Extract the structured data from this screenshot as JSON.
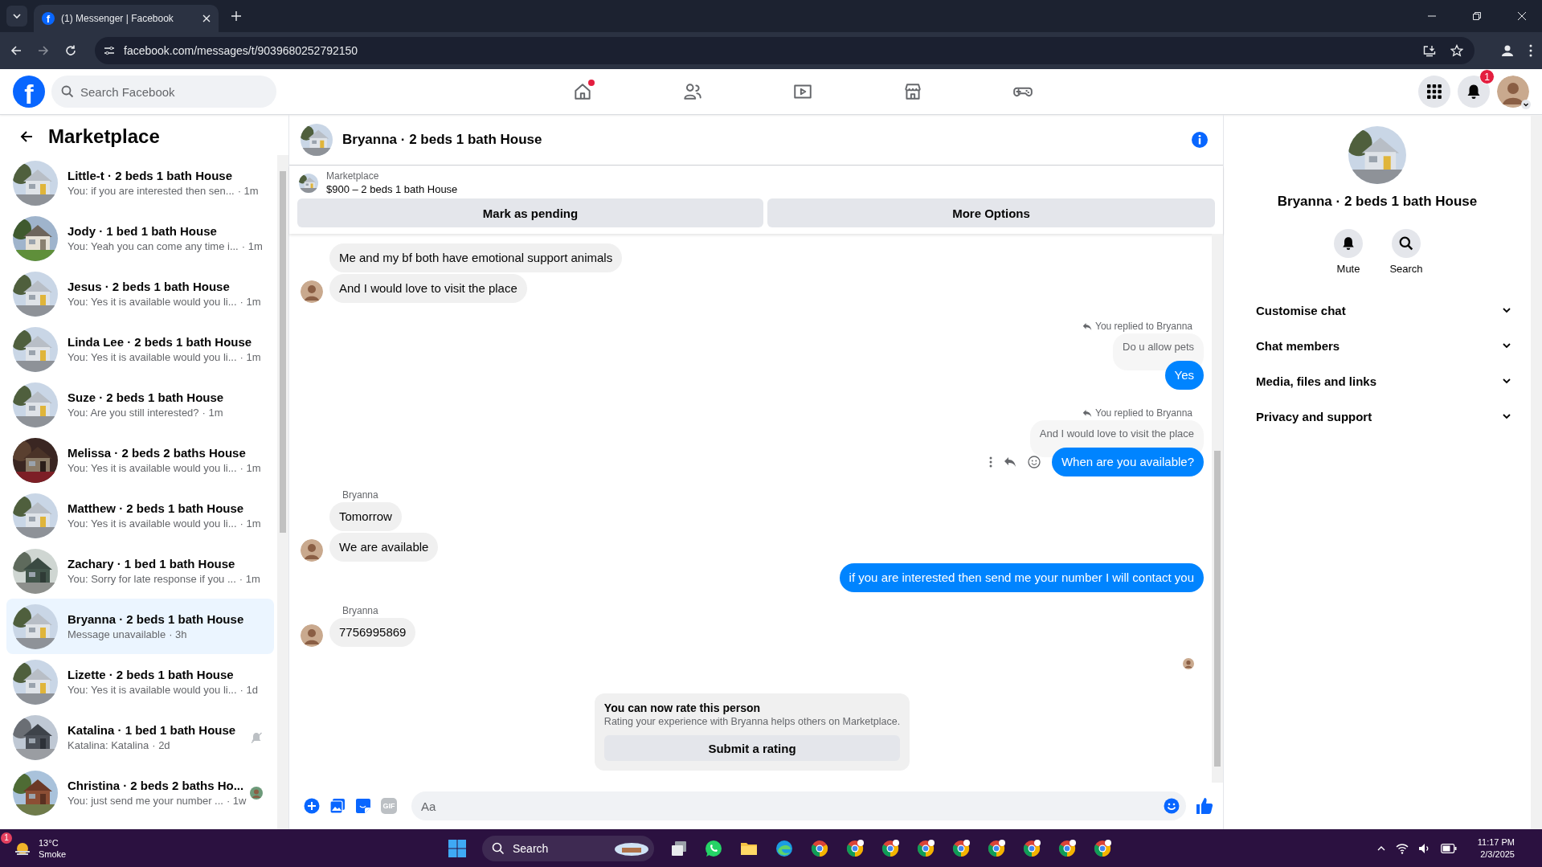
{
  "browser": {
    "favicon": "f",
    "tab_title": "(1) Messenger | Facebook",
    "url": "facebook.com/messages/t/9039680252792150"
  },
  "topbar": {
    "logo": "f",
    "search_placeholder": "Search Facebook",
    "nav": [
      {
        "kind": "home",
        "dot": true
      },
      {
        "kind": "friends",
        "dot": false
      },
      {
        "kind": "video",
        "dot": false
      },
      {
        "kind": "store",
        "dot": false
      },
      {
        "kind": "gaming",
        "dot": false
      }
    ],
    "notification_count": "1"
  },
  "sidebar": {
    "title": "Marketplace",
    "conversations": [
      {
        "title": "Little-t · 2 beds 1 bath House",
        "preview": "You: if you are interested then sen...",
        "time": "· 1m",
        "selected": false,
        "muted": false,
        "seen": false
      },
      {
        "title": "Jody · 1 bed 1 bath House",
        "preview": "You: Yeah you can come any time i...",
        "time": "· 1m",
        "selected": false,
        "muted": false,
        "seen": false
      },
      {
        "title": "Jesus · 2 beds 1 bath House",
        "preview": "You: Yes it is available would you li...",
        "time": "· 1m",
        "selected": false,
        "muted": false,
        "seen": false
      },
      {
        "title": "Linda Lee · 2 beds 1 bath House",
        "preview": "You: Yes it is available would you li...",
        "time": "· 1m",
        "selected": false,
        "muted": false,
        "seen": false
      },
      {
        "title": "Suze · 2 beds 1 bath House",
        "preview": "You: Are you still interested?",
        "time": "· 1m",
        "selected": false,
        "muted": false,
        "seen": false
      },
      {
        "title": "Melissa · 2 beds 2 baths House",
        "preview": "You: Yes it is available would you li...",
        "time": "· 1m",
        "selected": false,
        "muted": false,
        "seen": false
      },
      {
        "title": "Matthew · 2 beds 1 bath House",
        "preview": "You: Yes it is available would you li...",
        "time": "· 1m",
        "selected": false,
        "muted": false,
        "seen": false
      },
      {
        "title": "Zachary · 1 bed 1 bath House",
        "preview": "You: Sorry for late response if you ...",
        "time": "· 1m",
        "selected": false,
        "muted": false,
        "seen": false
      },
      {
        "title": "Bryanna · 2 beds 1 bath House",
        "preview": "Message unavailable",
        "time": "· 3h",
        "selected": true,
        "muted": false,
        "seen": false
      },
      {
        "title": "Lizette · 2 beds 1 bath House",
        "preview": "You: Yes it is available would you li...",
        "time": "· 1d",
        "selected": false,
        "muted": false,
        "seen": false
      },
      {
        "title": "Katalina · 1 bed 1 bath House",
        "preview": "Katalina: Katalina",
        "time": "· 2d",
        "selected": false,
        "muted": true,
        "seen": false
      },
      {
        "title": "Christina · 2 beds 2 baths Ho...",
        "preview": "You: just send me your number ...",
        "time": "· 1w",
        "selected": false,
        "muted": false,
        "seen": true
      }
    ]
  },
  "chat": {
    "title": "Bryanna · 2 beds 1 bath House",
    "listing": {
      "label": "Marketplace",
      "summary": "$900 – 2 beds 1 bath House"
    },
    "actions": [
      "Mark as pending",
      "More Options"
    ],
    "messages": [
      {
        "kind": "incoming",
        "text": "Me and my bf both have emotional support animals",
        "avatar": false
      },
      {
        "kind": "incoming",
        "text": "And I would love to visit the place",
        "avatar": true
      },
      {
        "kind": "reply_note",
        "text": "You replied to Bryanna"
      },
      {
        "kind": "quoted",
        "text": "Do u allow pets"
      },
      {
        "kind": "outgoing",
        "text": "Yes",
        "actions": false
      },
      {
        "kind": "reply_note",
        "text": "You replied to Bryanna"
      },
      {
        "kind": "quoted",
        "text": "And I would love to visit the place"
      },
      {
        "kind": "outgoing",
        "text": "When are you available?",
        "actions": true
      },
      {
        "kind": "sender",
        "text": "Bryanna"
      },
      {
        "kind": "incoming",
        "text": "Tomorrow",
        "avatar": false
      },
      {
        "kind": "incoming",
        "text": "We are available",
        "avatar": true
      },
      {
        "kind": "outgoing",
        "text": "if you are interested then send me your number I will contact you",
        "actions": false
      },
      {
        "kind": "sender",
        "text": "Bryanna"
      },
      {
        "kind": "incoming",
        "text": "7756995869",
        "avatar": true
      },
      {
        "kind": "seen"
      }
    ],
    "rating": {
      "title": "You can now rate this person",
      "text": "Rating your experience with Bryanna helps others on Marketplace.",
      "button": "Submit a rating"
    },
    "composer": {
      "gif_label": "GIF",
      "placeholder": "Aa"
    }
  },
  "details": {
    "title": "Bryanna · 2 beds 1 bath House",
    "actions": [
      {
        "kind": "mute",
        "label": "Mute"
      },
      {
        "kind": "search",
        "label": "Search"
      }
    ],
    "sections": [
      {
        "label": "Customise chat",
        "expanded": false
      },
      {
        "label": "Chat members",
        "expanded": false
      },
      {
        "label": "Media, files and links",
        "expanded": false
      },
      {
        "label": "Privacy and support",
        "expanded": false
      }
    ]
  },
  "taskbar": {
    "weather": {
      "badge": "1",
      "temp": "13°C",
      "condition": "Smoke"
    },
    "search_label": "Search",
    "time": "11:17 PM",
    "date": "2/3/2025"
  }
}
